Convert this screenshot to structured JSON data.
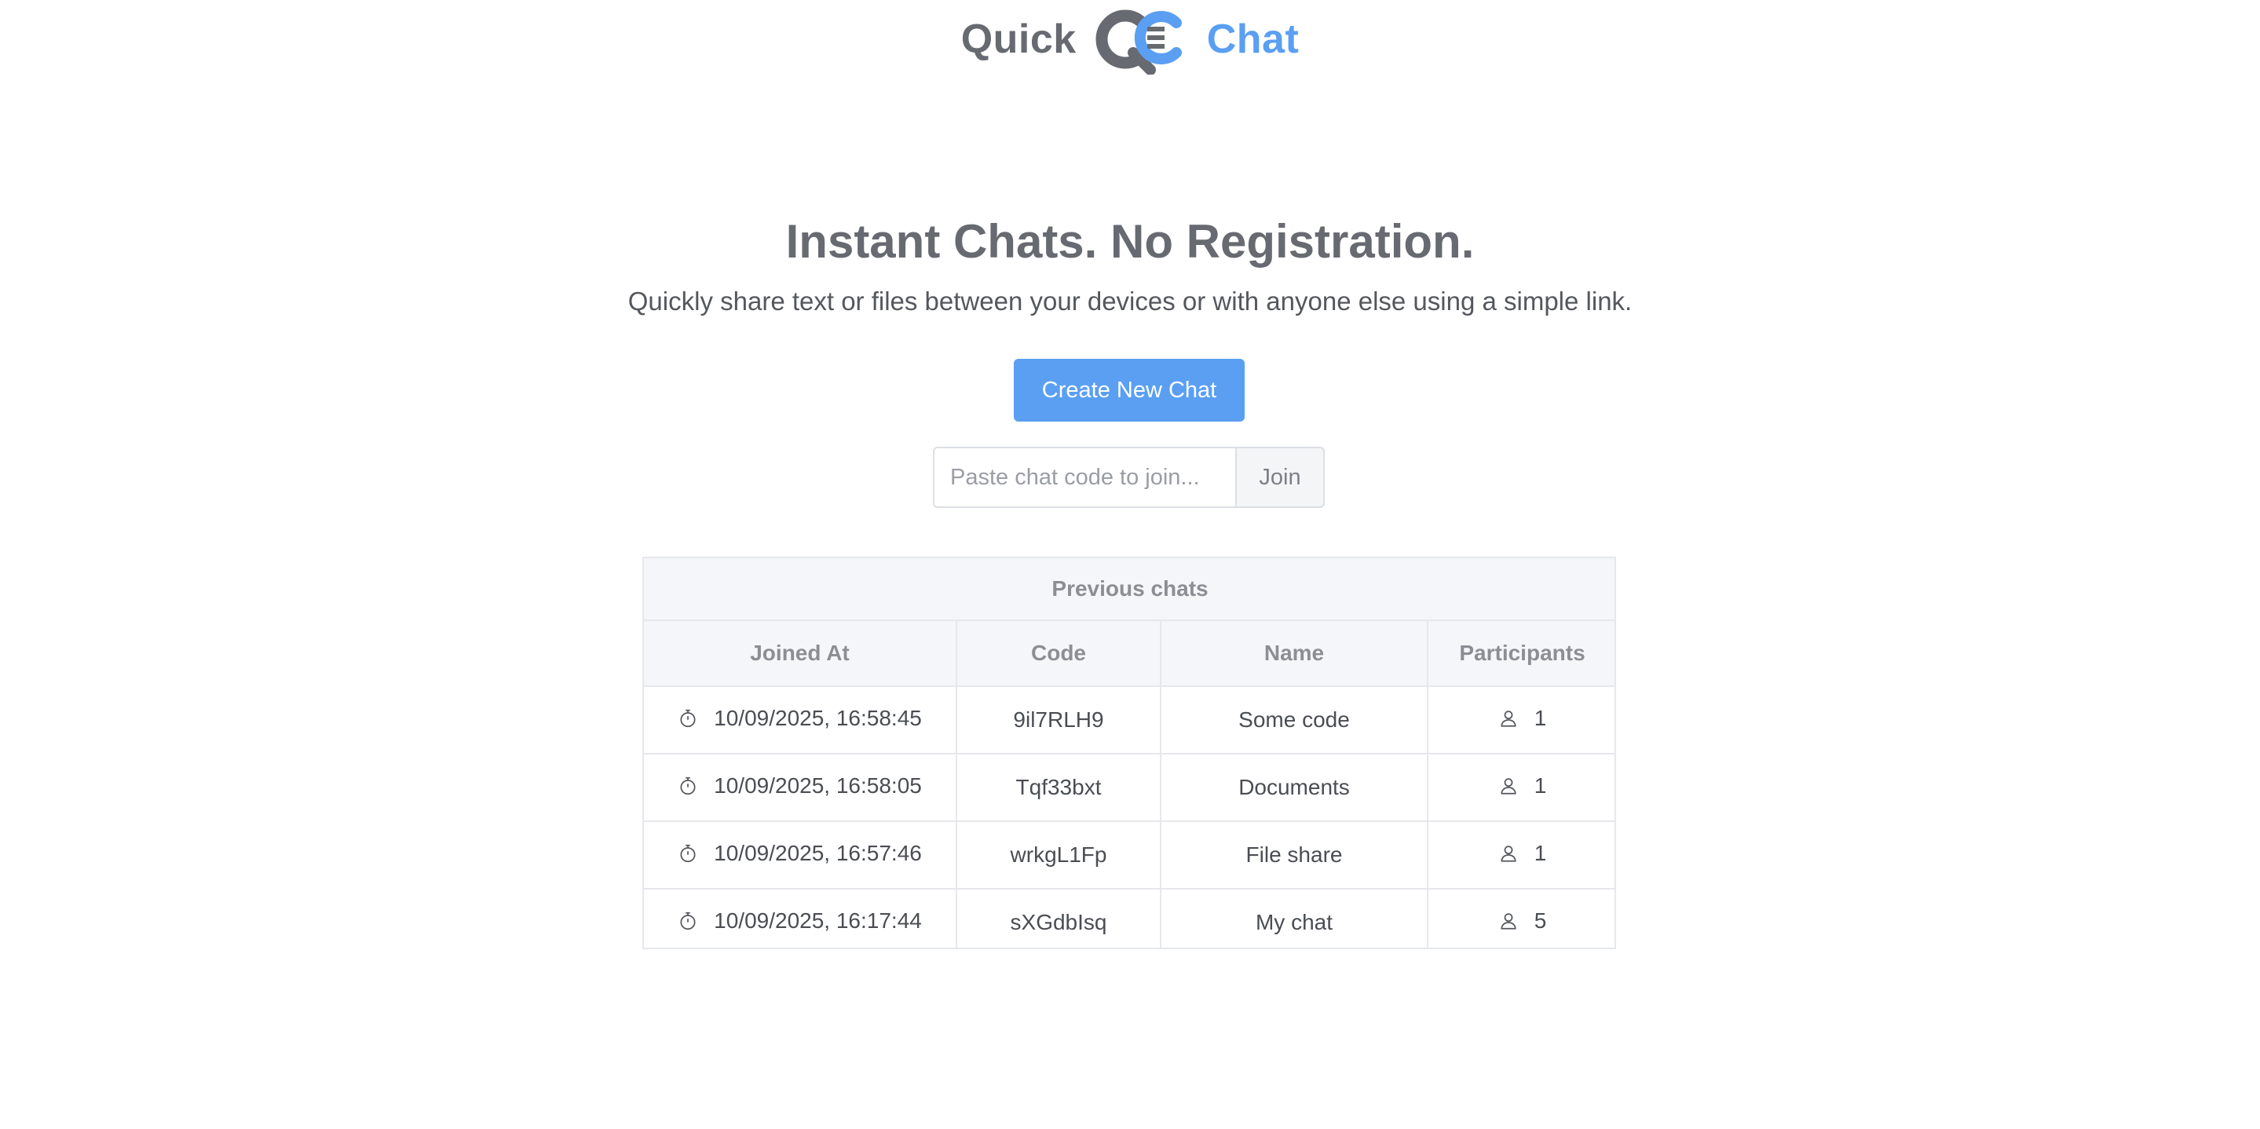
{
  "header": {
    "brand_left": "Quick",
    "brand_right": "Chat",
    "logo_letters": "QC"
  },
  "hero": {
    "title": "Instant Chats. No Registration.",
    "subtitle": "Quickly share text or files between your devices or with anyone else using a simple link."
  },
  "actions": {
    "create_label": "Create New Chat",
    "join_placeholder": "Paste chat code to join...",
    "join_label": "Join"
  },
  "previous_chats": {
    "caption": "Previous chats",
    "columns": [
      "Joined At",
      "Code",
      "Name",
      "Participants"
    ],
    "rows": [
      {
        "joined_at": "10/09/2025, 16:58:45",
        "code": "9il7RLH9",
        "name": "Some code",
        "participants": "1"
      },
      {
        "joined_at": "10/09/2025, 16:58:05",
        "code": "Tqf33bxt",
        "name": "Documents",
        "participants": "1"
      },
      {
        "joined_at": "10/09/2025, 16:57:46",
        "code": "wrkgL1Fp",
        "name": "File share",
        "participants": "1"
      },
      {
        "joined_at": "10/09/2025, 16:17:44",
        "code": "sXGdbIsq",
        "name": "My chat",
        "participants": "5"
      }
    ]
  },
  "icons": {
    "timer": "stopwatch-icon",
    "participants": "user-icon"
  },
  "colors": {
    "accent": "#5a9ff2",
    "brand_gray": "#676a70",
    "border": "#e6e8ec",
    "header_bg": "#f5f6f9"
  }
}
